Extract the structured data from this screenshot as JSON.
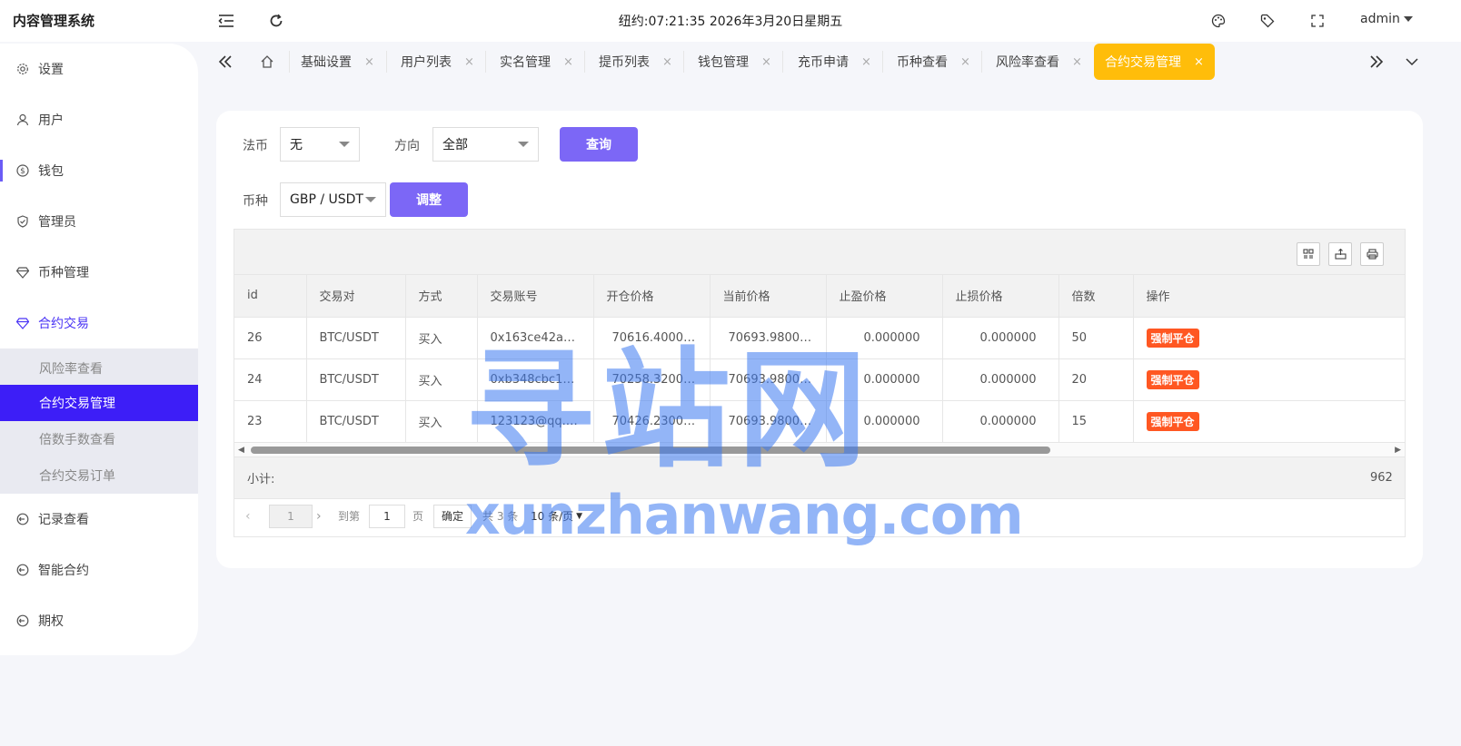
{
  "app": {
    "title": "内容管理系统"
  },
  "header": {
    "clock": "纽约:07:21:35 2026年3月20日星期五",
    "user": "admin"
  },
  "sidebar": {
    "items": [
      {
        "label": "设置",
        "icon": "gear-icon"
      },
      {
        "label": "用户",
        "icon": "user-icon"
      },
      {
        "label": "钱包",
        "icon": "dollar-icon"
      },
      {
        "label": "管理员",
        "icon": "shield-icon"
      },
      {
        "label": "币种管理",
        "icon": "diamond-icon"
      },
      {
        "label": "合约交易",
        "icon": "diamond-icon"
      }
    ],
    "sub_items": [
      {
        "label": "风险率查看"
      },
      {
        "label": "合约交易管理"
      },
      {
        "label": "倍数手数查看"
      },
      {
        "label": "合约交易订单"
      }
    ],
    "bottom_items": [
      {
        "label": "记录查看",
        "icon": "history-icon"
      },
      {
        "label": "智能合约",
        "icon": "history-icon"
      },
      {
        "label": "期权",
        "icon": "history-icon"
      }
    ]
  },
  "tabs": [
    {
      "label": "基础设置"
    },
    {
      "label": "用户列表"
    },
    {
      "label": "实名管理"
    },
    {
      "label": "提币列表"
    },
    {
      "label": "钱包管理"
    },
    {
      "label": "充币申请"
    },
    {
      "label": "币种查看"
    },
    {
      "label": "风险率查看"
    },
    {
      "label": "合约交易管理"
    }
  ],
  "tab_close": "×",
  "filters": {
    "fiat_label": "法币",
    "fiat_value": "无",
    "direction_label": "方向",
    "direction_value": "全部",
    "query_button": "查询",
    "currency_label": "币种",
    "currency_value": "GBP / USDT",
    "adjust_button": "调整"
  },
  "table": {
    "columns": [
      "id",
      "交易对",
      "方式",
      "交易账号",
      "开仓价格",
      "当前价格",
      "止盈价格",
      "止损价格",
      "倍数",
      "操作"
    ],
    "rows": [
      {
        "id": "26",
        "pair": "BTC/USDT",
        "type": "买入",
        "account": "0x163ce42a9b...",
        "open": "70616.400000",
        "current": "70693.980000",
        "tp": "0.000000",
        "sl": "0.000000",
        "lev": "50",
        "action": "强制平仓"
      },
      {
        "id": "24",
        "pair": "BTC/USDT",
        "type": "买入",
        "account": "0xb348cbc104...",
        "open": "70258.320000",
        "current": "70693.980000",
        "tp": "0.000000",
        "sl": "0.000000",
        "lev": "20",
        "action": "强制平仓"
      },
      {
        "id": "23",
        "pair": "BTC/USDT",
        "type": "买入",
        "account": "123123@qq.com",
        "open": "70426.230000",
        "current": "70693.980000",
        "tp": "0.000000",
        "sl": "0.000000",
        "lev": "15",
        "action": "强制平仓"
      }
    ],
    "subtotal_label": "小计:",
    "subtotal_value": "962"
  },
  "pager": {
    "current": "1",
    "goto_label": "到第",
    "goto_value": "1",
    "page_unit": "页",
    "confirm": "确定",
    "total": "共 3 条",
    "page_size": "10 条/页"
  },
  "watermark": {
    "cn": "寻站网",
    "en": "xunzhanwang.com"
  },
  "colors": {
    "accent": "#3d1ef7",
    "button": "#7c67f6",
    "active_tab": "#ffbd0a",
    "danger": "#ff5722"
  }
}
